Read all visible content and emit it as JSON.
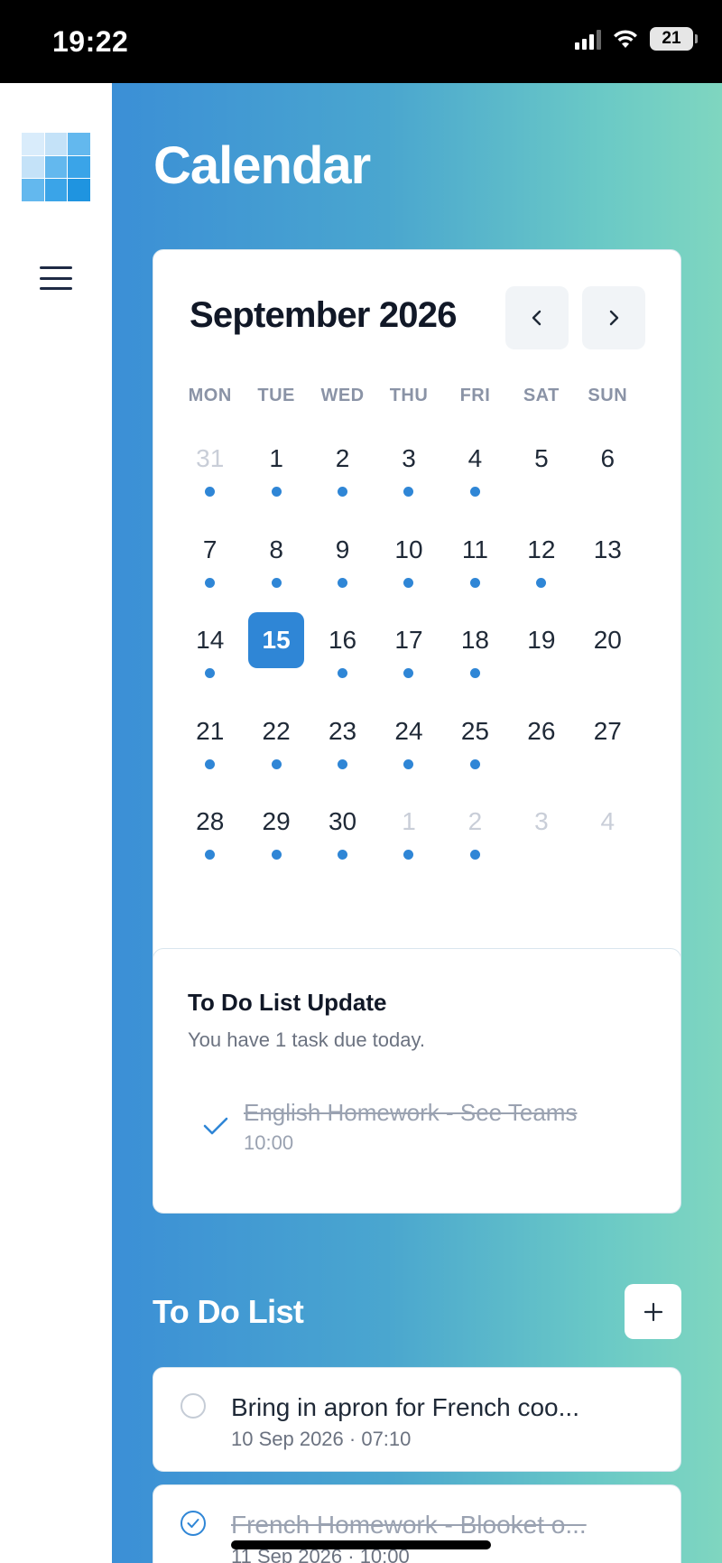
{
  "status_bar": {
    "time": "19:22",
    "battery": "21"
  },
  "sidebar": {
    "logo_label": "app-logo",
    "menu_icon": "hamburger-menu-icon"
  },
  "page": {
    "title": "Calendar"
  },
  "calendar": {
    "month_label": "September 2026",
    "prev_icon": "chevron-left-icon",
    "next_icon": "chevron-right-icon",
    "weekdays": [
      "MON",
      "TUE",
      "WED",
      "THU",
      "FRI",
      "SAT",
      "SUN"
    ],
    "accent_color": "#2f86d6",
    "days": [
      {
        "label": "31",
        "muted": true,
        "dot": true
      },
      {
        "label": "1",
        "dot": true
      },
      {
        "label": "2",
        "dot": true
      },
      {
        "label": "3",
        "dot": true
      },
      {
        "label": "4",
        "dot": true
      },
      {
        "label": "5"
      },
      {
        "label": "6"
      },
      {
        "label": "7",
        "dot": true
      },
      {
        "label": "8",
        "dot": true
      },
      {
        "label": "9",
        "dot": true
      },
      {
        "label": "10",
        "dot": true
      },
      {
        "label": "11",
        "dot": true
      },
      {
        "label": "12",
        "dot": true
      },
      {
        "label": "13"
      },
      {
        "label": "14",
        "dot": true
      },
      {
        "label": "15",
        "today": true
      },
      {
        "label": "16",
        "dot": true
      },
      {
        "label": "17",
        "dot": true
      },
      {
        "label": "18",
        "dot": true
      },
      {
        "label": "19"
      },
      {
        "label": "20"
      },
      {
        "label": "21",
        "dot": true
      },
      {
        "label": "22",
        "dot": true
      },
      {
        "label": "23",
        "dot": true
      },
      {
        "label": "24",
        "dot": true
      },
      {
        "label": "25",
        "dot": true
      },
      {
        "label": "26"
      },
      {
        "label": "27"
      },
      {
        "label": "28",
        "dot": true
      },
      {
        "label": "29",
        "dot": true
      },
      {
        "label": "30",
        "dot": true
      },
      {
        "label": "1",
        "muted": true,
        "dot": true
      },
      {
        "label": "2",
        "muted": true,
        "dot": true
      },
      {
        "label": "3",
        "muted": true
      },
      {
        "label": "4",
        "muted": true
      }
    ]
  },
  "update": {
    "title": "To Do List Update",
    "subtitle": "You have 1 task due today.",
    "task": {
      "title": "English Homework - See Teams",
      "time": "10:00",
      "done": true
    }
  },
  "todo": {
    "title": "To Do List",
    "add_icon": "plus-icon",
    "items": [
      {
        "text": "Bring in apron for French coo...",
        "meta": "10 Sep 2026 · 07:10",
        "done": false
      },
      {
        "text": "French Homework - Blooket o...",
        "meta": "11 Sep 2026 · 10:00",
        "done": true
      }
    ]
  }
}
